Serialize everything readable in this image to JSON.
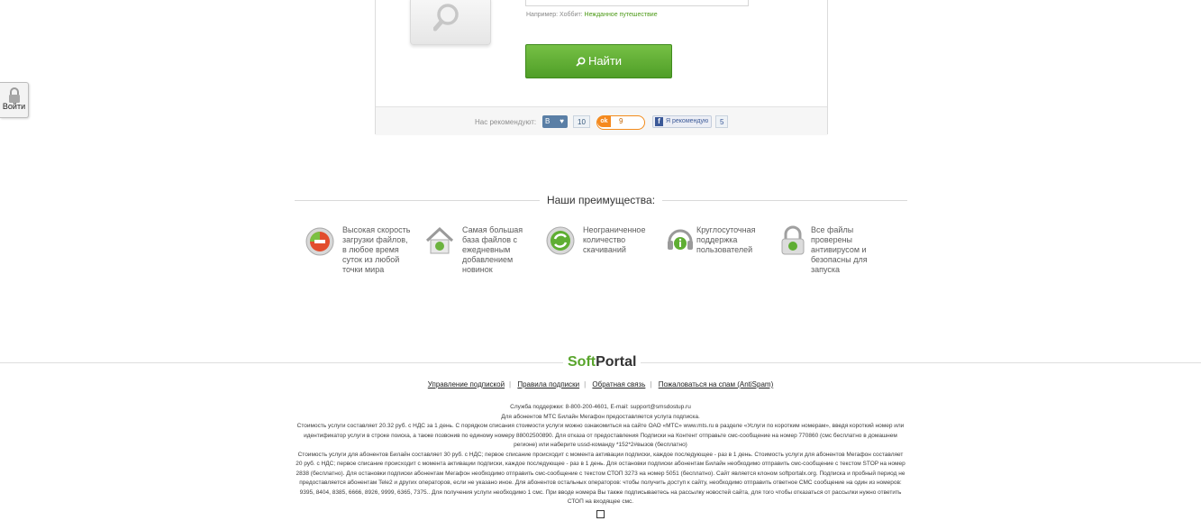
{
  "login": {
    "label": "Войти"
  },
  "search": {
    "example_prefix": "Например: Хоббит:",
    "example_link": "Нежданное путешествие",
    "find_label": "Найти"
  },
  "recommend": {
    "label": "Нас рекомендуют:",
    "vk_label": "В",
    "vk_count": "10",
    "ok_count": "9",
    "fb_label": "Я рекомендую",
    "fb_count": "5"
  },
  "advantages": {
    "title": "Наши преимущества:",
    "items": [
      {
        "icon": "speed-icon",
        "text": "Высокая скорость загрузки файлов, в любое время суток из любой точки мира"
      },
      {
        "icon": "home-icon",
        "text": "Самая большая база файлов с ежедневным добавлением новинок"
      },
      {
        "icon": "refresh-icon",
        "text": "Неограниченное количество скачиваний"
      },
      {
        "icon": "support-icon",
        "text": "Круглосуточная поддержка пользователей"
      },
      {
        "icon": "lock-icon",
        "text": "Все файлы проверены антивирусом и безопасны для запуска"
      }
    ]
  },
  "footer": {
    "logo_soft": "Soft",
    "logo_portal": "Portal",
    "links": [
      "Управление подпиской",
      "Правила подписки",
      "Обратная связь",
      "Пожаловаться на спам (AntiSpam)"
    ],
    "legal": [
      "Служба поддержки: 8-800-200-4601, E-mail: support@smsdostup.ru",
      "Для абонентов МТС Билайн Мегафон предоставляется услуга подписка.",
      "Стоимость услуги составляет 20.32 руб. с НДС за 1 день. С порядком списания стоимости услуги можно ознакомиться на сайте ОАО «МТС» www.mts.ru в разделе «Услуги по коротким номерам», введя короткий номер или идентификатор услуги в строке поиска, а также позвонив по единому номеру 88002500890. Для отказа от предоставления Подписки на Контент отправьте смс-сообщение на номер 770860 (смс бесплатно в домашнем регионе) или наберите ussd-команду *152*2#вызов (бесплатно)",
      "Стоимость услуги для абонентов Билайн составляет 30 руб. с НДС; первое списание происходит с момента активации подписки, каждое последующее - раз в 1 день. Стоимость услуги для абонентов Мегафон составляет 20 руб. с НДС; первое списание происходит с момента активации подписки, каждое последующее - раз в 1 день. Для остановки подписки абонентам Билайн необходимо отправить смс-сообщение с текстом STOP на номер 2838 (бесплатно). Для остановки подписки абонентам Мегафон необходимо отправить смс-сообщение с текстом СТОП 3273 на номер 5051 (бесплатно). Сайт является клоном softportalx.org. Подписка и пробный период не предоставляется абонентам Tele2 и других операторов, если не указано иное. Для абонентов остальных операторов: чтобы получить доступ к сайту, необходимо отправить ответное СМС сообщение на один из номеров: 9395, 8404, 8385, 6666, 8926, 9999, 6365, 7375.. Для получения услуги необходимо 1 смс. При вводе номера Вы также подписываетесь на рассылку новостей сайта, для того чтобы отказаться от рассылки нужно ответить СТОП на входящее смс."
    ]
  }
}
